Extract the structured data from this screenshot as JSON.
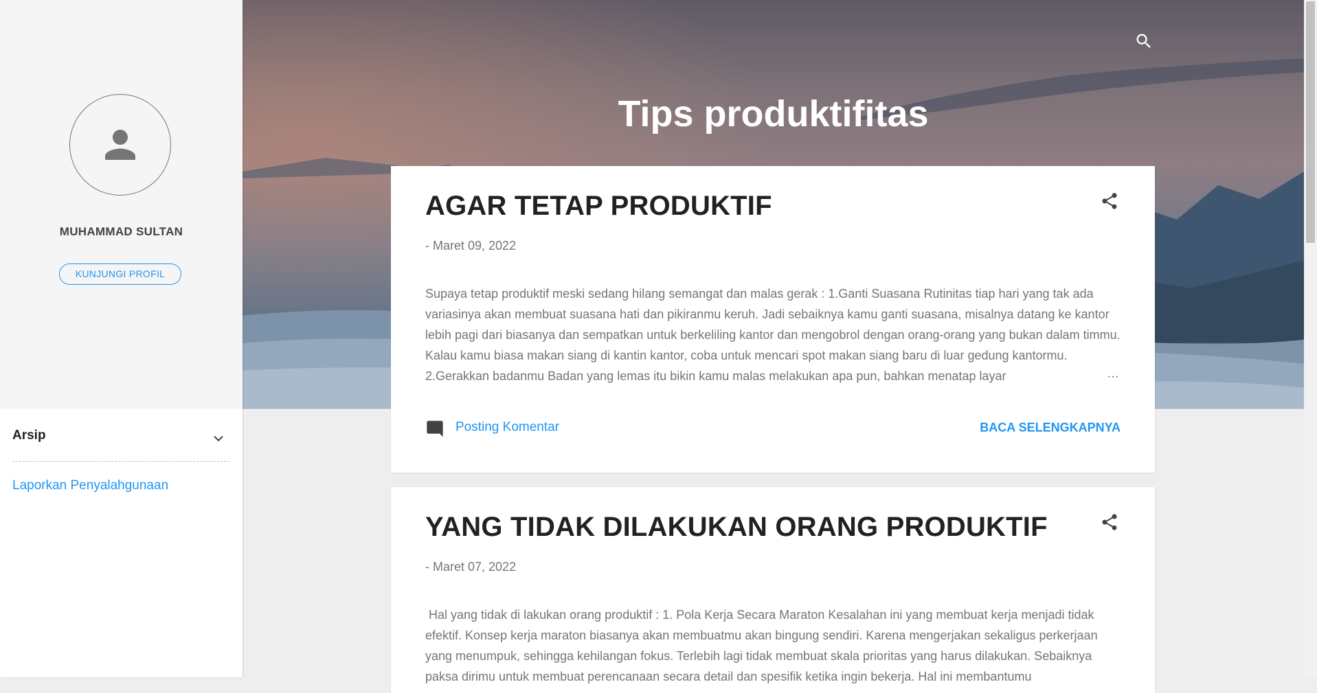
{
  "sidebar": {
    "profile_name": "MUHAMMAD SULTAN",
    "profile_button": "KUNJUNGI PROFIL",
    "archive_title": "Arsip",
    "report_link": "Laporkan Penyalahgunaan"
  },
  "header": {
    "title": "Tips produktifitas"
  },
  "posts": [
    {
      "title": "AGAR TETAP PRODUKTIF",
      "date": "- Maret 09, 2022",
      "snippet": "Supaya tetap produktif meski sedang hilang semangat dan malas gerak : 1.Ganti Suasana Rutinitas tiap hari yang tak ada variasinya akan membuat suasana hati dan pikiranmu keruh. Jadi sebaiknya kamu ganti suasana, misalnya datang ke kantor lebih pagi dari biasanya dan sempatkan untuk berkeliling kantor dan mengobrol dengan orang-orang yang bukan dalam timmu. Kalau kamu biasa makan siang di kantin kantor, coba untuk mencari  spot  makan siang baru di luar gedung kantormu.  2.Gerakkan badanmu Badan yang lemas itu bikin kamu malas melakukan apa pun, bahkan menatap layar",
      "ellipsis": "…",
      "comment_label": "Posting Komentar",
      "read_more": "BACA SELENGKAPNYA"
    },
    {
      "title": "YANG TIDAK DILAKUKAN ORANG PRODUKTIF",
      "date": "- Maret 07, 2022",
      "snippet": " Hal yang tidak di lakukan orang produktif : 1. Pola Kerja Secara Maraton Kesalahan ini yang membuat kerja menjadi tidak efektif. Konsep kerja maraton biasanya akan membuatmu akan bingung sendiri. Karena mengerjakan sekaligus perkerjaan yang menumpuk, sehingga kehilangan fokus. Terlebih lagi tidak membuat skala prioritas yang harus dilakukan. Sebaiknya paksa dirimu untuk membuat perencanaan secara detail dan spesifik ketika ingin bekerja. Hal ini membantumu"
    }
  ],
  "icons": {
    "avatar": "person-icon",
    "search": "search-icon",
    "share": "share-icon",
    "chevron": "chevron-down-icon",
    "comment": "comment-icon"
  },
  "colors": {
    "accent": "#2196f3",
    "sidebar_top": "#f5f5f5",
    "page_bg": "#eeeeee"
  }
}
